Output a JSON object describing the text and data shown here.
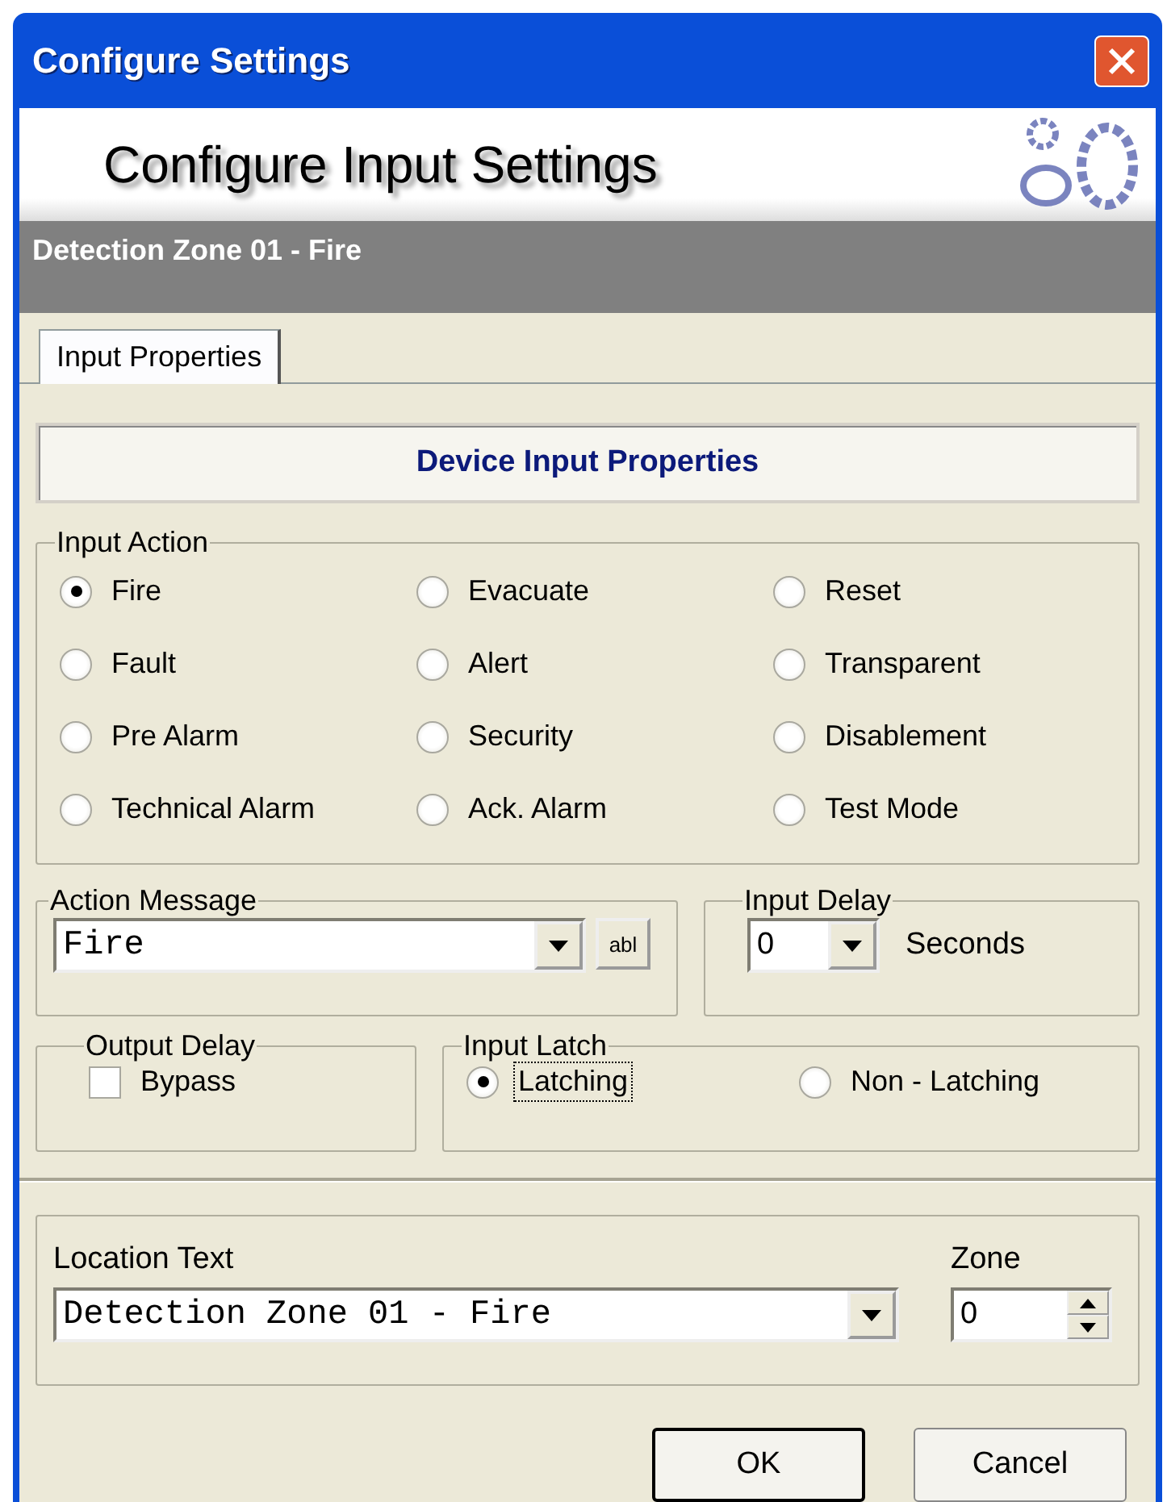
{
  "window": {
    "title": "Configure Settings"
  },
  "banner": {
    "title": "Configure Input Settings",
    "subtitle": "Detection Zone 01 - Fire"
  },
  "tabs": [
    {
      "label": "Input Properties",
      "selected": true
    }
  ],
  "section_title": "Device Input Properties",
  "input_action": {
    "label": "Input Action",
    "options": [
      {
        "label": "Fire",
        "selected": true
      },
      {
        "label": "Evacuate",
        "selected": false
      },
      {
        "label": "Reset",
        "selected": false
      },
      {
        "label": "Fault",
        "selected": false
      },
      {
        "label": "Alert",
        "selected": false
      },
      {
        "label": "Transparent",
        "selected": false
      },
      {
        "label": "Pre Alarm",
        "selected": false
      },
      {
        "label": "Security",
        "selected": false
      },
      {
        "label": "Disablement",
        "selected": false
      },
      {
        "label": "Technical Alarm",
        "selected": false
      },
      {
        "label": "Ack. Alarm",
        "selected": false
      },
      {
        "label": "Test Mode",
        "selected": false
      }
    ]
  },
  "action_message": {
    "label": "Action Message",
    "value": "Fire",
    "edit_button": "abl"
  },
  "input_delay": {
    "label": "Input Delay",
    "value": "0",
    "unit": "Seconds"
  },
  "output_delay": {
    "label": "Output Delay",
    "bypass": {
      "label": "Bypass",
      "checked": false
    }
  },
  "input_latch": {
    "label": "Input Latch",
    "options": [
      {
        "label": "Latching",
        "selected": true,
        "focused": true
      },
      {
        "label": "Non - Latching",
        "selected": false,
        "focused": false
      }
    ]
  },
  "location": {
    "label": "Location Text",
    "value": "Detection Zone 01 - Fire"
  },
  "zone": {
    "label": "Zone",
    "value": "0"
  },
  "buttons": [
    {
      "label": "OK",
      "default": true
    },
    {
      "label": "Cancel",
      "default": false
    }
  ]
}
